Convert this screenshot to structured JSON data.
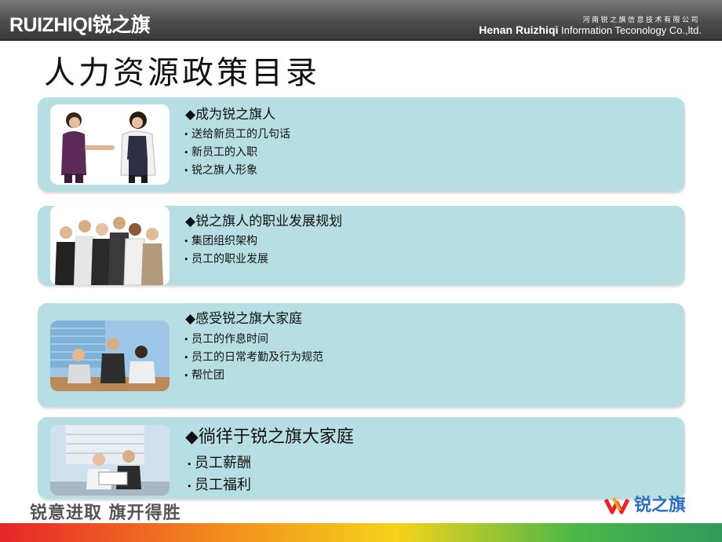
{
  "header": {
    "logo_text": "RUIZHIQI锐之旗",
    "company_cn": "河南锐之旗信息技术有限公司",
    "company_en_bold": "Henan Ruizhiqi",
    "company_en_rest": " Information Teconology Co.,ltd."
  },
  "title": "人力资源政策目录",
  "sections": [
    {
      "title": "◆成为锐之旗人",
      "items": [
        "送给新员工的几句话",
        "新员工的入职",
        "锐之旗人形象"
      ]
    },
    {
      "title": "◆锐之旗人的职业发展规划",
      "items": [
        "集团组织架构",
        "员工的职业发展"
      ]
    },
    {
      "title": "◆感受锐之旗大家庭",
      "items": [
        "员工的作息时间",
        "员工的日常考勤及行为规范",
        "帮忙团"
      ]
    },
    {
      "title": "◆徜徉于锐之旗大家庭",
      "items": [
        "员工薪酬",
        "员工福利"
      ]
    }
  ],
  "footer": {
    "slogan": "锐意进取   旗开得胜",
    "logo_text": "锐之旗"
  },
  "colors": {
    "panel": "#b7dfe3",
    "header": "#4c4c4c",
    "logo_red": "#e62429",
    "logo_blue": "#2a6fc0"
  }
}
